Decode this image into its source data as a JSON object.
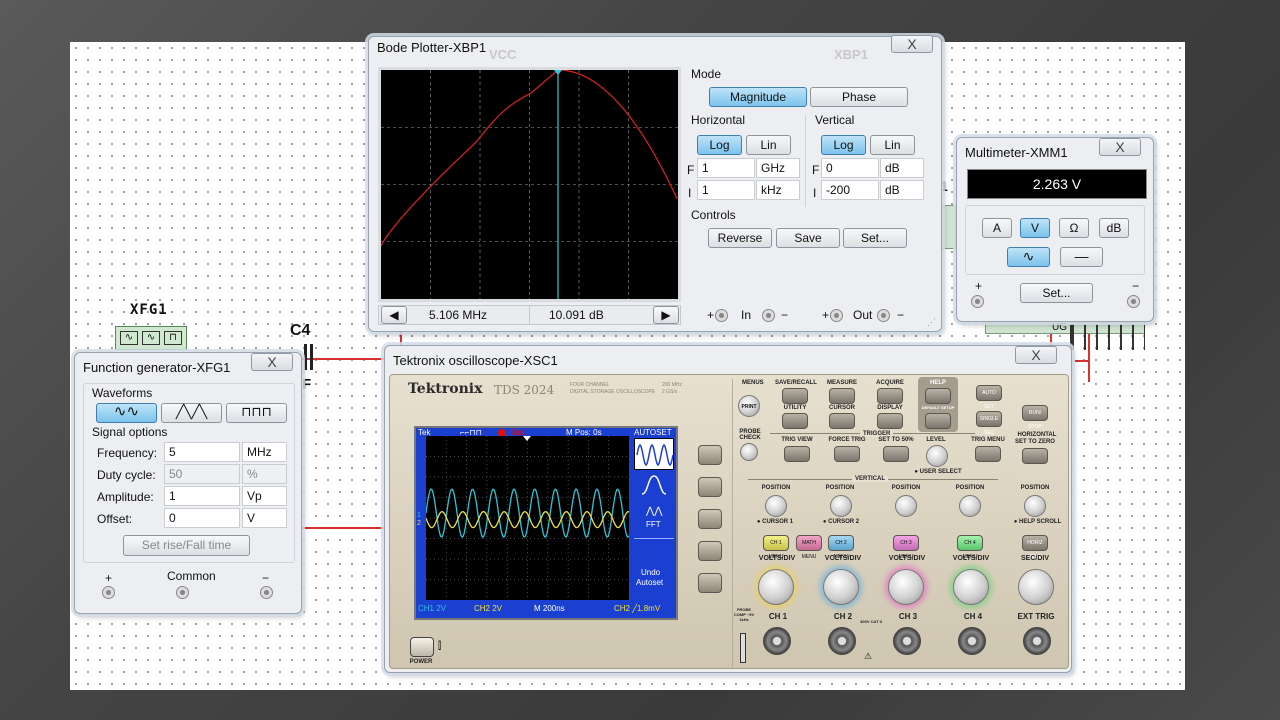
{
  "colors": {
    "wire": "#d93030",
    "bode_trace": "#e02020",
    "cursor": "#34c6d6",
    "ch1": "#2ec4d6",
    "ch2": "#f0e040",
    "accent_btn": "#7cc3ec"
  },
  "schematic": {
    "xfg1_label": "XFG1",
    "c4_label": "C4",
    "f_label": "F",
    "vcc_label": "VCC",
    "xbp1_label": "XBP1",
    "ug_label": "UG",
    "r_label": "1"
  },
  "bode": {
    "title": "Bode Plotter-XBP1",
    "close": "X",
    "mode_label": "Mode",
    "magnitude": "Magnitude",
    "phase": "Phase",
    "horizontal_label": "Horizontal",
    "vertical_label": "Vertical",
    "log": "Log",
    "lin": "Lin",
    "h_f_prefix": "F",
    "h_i_prefix": "I",
    "h_f_value": "1",
    "h_f_unit": "GHz",
    "h_i_value": "1",
    "h_i_unit": "kHz",
    "v_f_prefix": "F",
    "v_i_prefix": "I",
    "v_f_value": "0",
    "v_f_unit": "dB",
    "v_i_value": "-200",
    "v_i_unit": "dB",
    "controls_label": "Controls",
    "reverse": "Reverse",
    "save": "Save",
    "set": "Set...",
    "freq_readout": "5.106 MHz",
    "db_readout": "10.091 dB",
    "in_label": "In",
    "out_label": "Out",
    "plus": "+",
    "minus": "−"
  },
  "multimeter": {
    "title": "Multimeter-XMM1",
    "close": "X",
    "display": "2.263 V",
    "buttons": [
      "A",
      "V",
      "Ω",
      "dB"
    ],
    "set": "Set...",
    "plus": "+",
    "minus": "−"
  },
  "fgen": {
    "title": "Function generator-XFG1",
    "close": "X",
    "waveforms_label": "Waveforms",
    "signal_options_label": "Signal options",
    "rows": [
      {
        "label": "Frequency:",
        "value": "5",
        "unit": "MHz"
      },
      {
        "label": "Duty cycle:",
        "value": "50",
        "unit": "%"
      },
      {
        "label": "Amplitude:",
        "value": "1",
        "unit": "Vp"
      },
      {
        "label": "Offset:",
        "value": "0",
        "unit": "V"
      }
    ],
    "set_rise": "Set rise/Fall time",
    "plus": "+",
    "common": "Common",
    "minus": "−"
  },
  "scope": {
    "title": "Tektronix oscilloscope-XSC1",
    "close": "X",
    "brand": "Tektronix",
    "model": "TDS 2024",
    "model_sub1": "FOUR CHANNEL",
    "model_sub2": "DIGITAL STORAGE OSCILLOSCOPE",
    "spec1": "200 MHz",
    "spec2": "2 GS/s",
    "screen": {
      "tek": "Tek",
      "stop": "Stop",
      "mpos": "M Pos: 0s",
      "autoset": "AUTOSET",
      "fft": "FFT",
      "undo1": "Undo",
      "undo2": "Autoset",
      "ch1": "CH1  2V",
      "ch2": "CH2  2V",
      "time": "M 200ns",
      "trig": "CH2 ╱1.8mV",
      "marker1": "1",
      "marker2": "2"
    },
    "top_buttons": [
      {
        "label": "SAVE/RECALL"
      },
      {
        "label": "MEASURE"
      },
      {
        "label": "ACQUIRE"
      },
      {
        "label": "HELP"
      },
      {
        "label": "UTILITY"
      },
      {
        "label": "CURSOR"
      },
      {
        "label": "DISPLAY"
      },
      {
        "label": "DEFAULT SETUP"
      }
    ],
    "menus": "MENUS",
    "print": "PRINT",
    "probe_check": "PROBE CHECK",
    "autoset_btn": "AUTO SET",
    "single_seq": "SINGLE SEQ",
    "run_stop": "RUN/ STOP",
    "trigger_label": "TRIGGER",
    "trig_view": "TRIG VIEW",
    "force_trig": "FORCE TRIG",
    "set_50": "SET TO 50%",
    "level": "LEVEL",
    "trig_menu": "TRIG MENU",
    "user_select": "● USER SELECT",
    "horizontal_label": "HORIZONTAL",
    "set_zero": "SET TO ZERO",
    "vertical_label": "VERTICAL",
    "position": "POSITION",
    "cursor1": "● CURSOR 1",
    "cursor2": "● CURSOR 2",
    "help_scroll": "● HELP SCROLL",
    "ch_menus": [
      "CH 1 MENU",
      "MATH MENU",
      "CH 2 MENU",
      "CH 3 MENU",
      "CH 4 MENU",
      "HORIZ MENU"
    ],
    "volts_div": "VOLTS/DIV",
    "sec_div": "SEC/DIV",
    "inputs": [
      "CH 1",
      "CH 2",
      "CH 3",
      "CH 4",
      "EXT TRIG"
    ],
    "probe_comp": "PROBE COMP ~5V 1kHz",
    "cat": "300V CAT II",
    "power": "POWER"
  }
}
